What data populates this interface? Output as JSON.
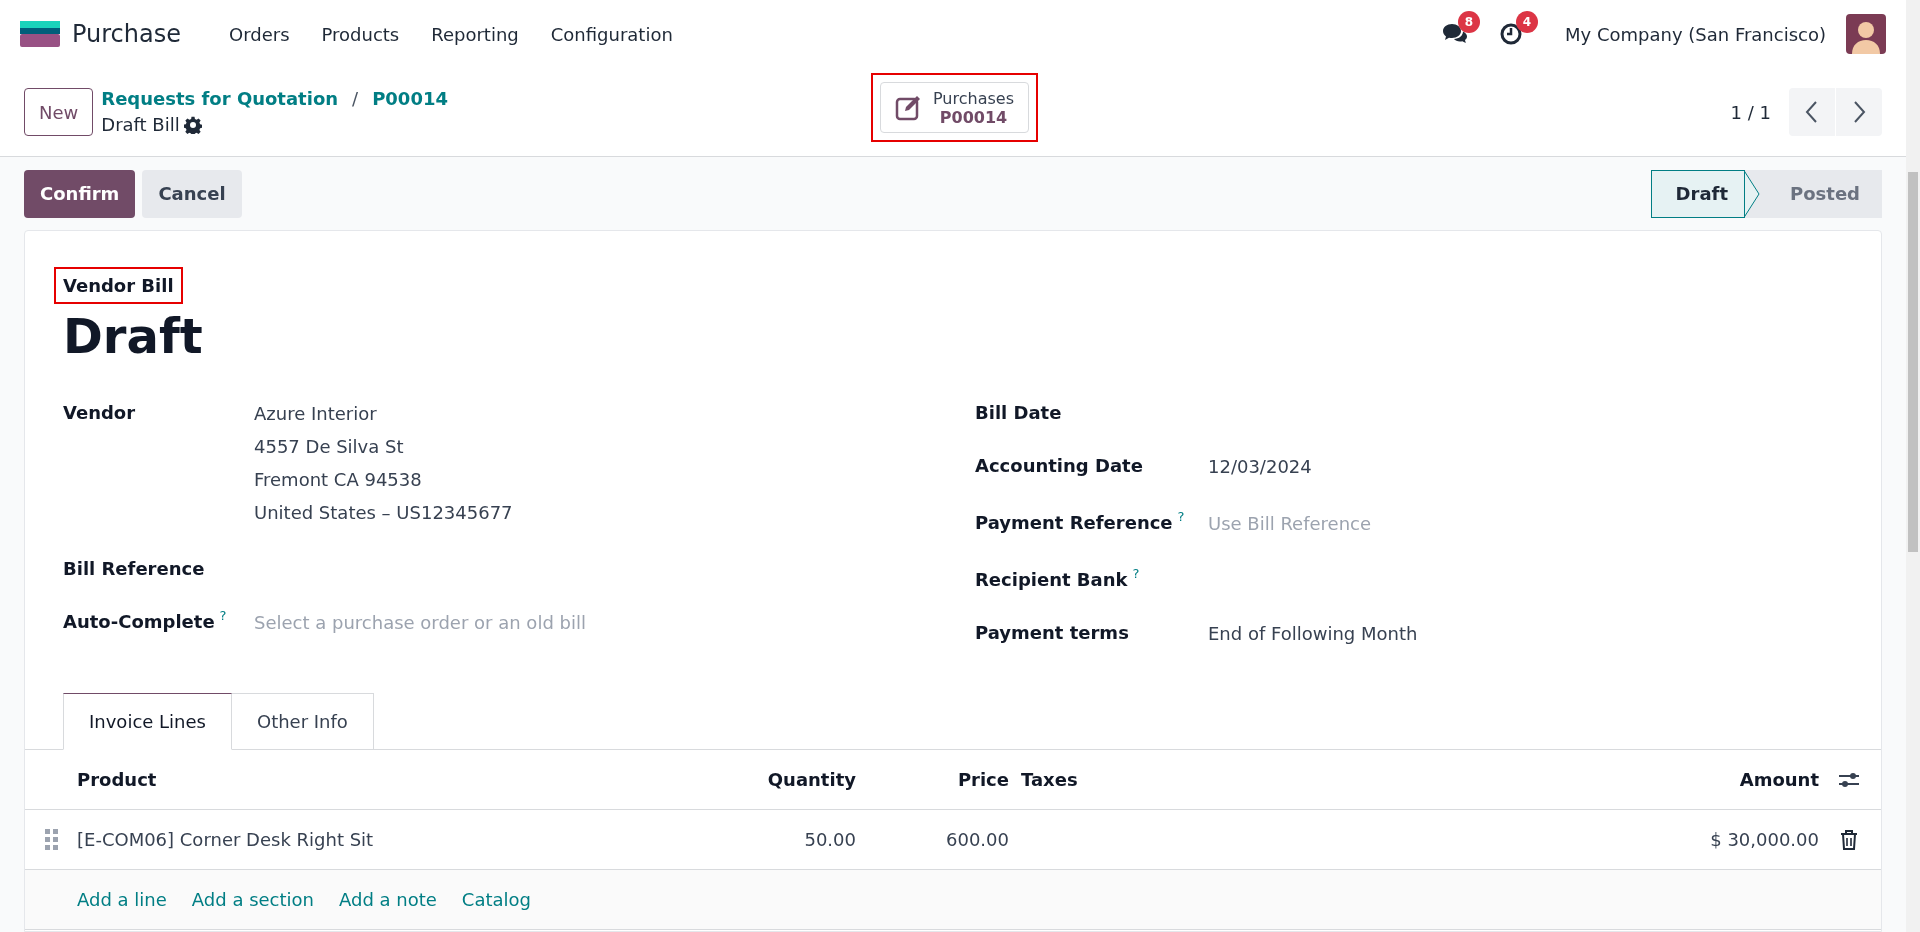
{
  "navbar": {
    "app": "Purchase",
    "menu": [
      "Orders",
      "Products",
      "Reporting",
      "Configuration"
    ],
    "messages_badge": "8",
    "activities_badge": "4",
    "company": "My Company (San Francisco)"
  },
  "control_panel": {
    "new_button": "New",
    "breadcrumb": [
      "Requests for Quotation",
      "P00014"
    ],
    "separator": "/",
    "record": "Draft Bill",
    "smart_button": {
      "label": "Purchases",
      "value": "P00014",
      "highlighted": true
    },
    "pager": "1 / 1"
  },
  "actions": [
    {
      "label": "Confirm",
      "kind": "primary"
    },
    {
      "label": "Cancel",
      "kind": "secondary"
    }
  ],
  "statusbar": [
    {
      "label": "Draft",
      "selected": true
    },
    {
      "label": "Posted",
      "selected": false
    }
  ],
  "form": {
    "type": {
      "label": "Vendor Bill",
      "highlighted": true
    },
    "title": "Draft",
    "left_fields": [
      {
        "label": "Vendor",
        "lines": [
          "Azure Interior",
          "4557 De Silva St",
          "Fremont CA 94538",
          "United States – US12345677"
        ]
      },
      {
        "label": "Bill Reference"
      },
      {
        "label": "Auto-Complete",
        "help": "?",
        "placeholder": "Select a purchase order or an old bill"
      }
    ],
    "right_fields": [
      {
        "label": "Bill Date"
      },
      {
        "label": "Accounting Date",
        "lines": [
          "12/03/2024"
        ]
      },
      {
        "label": "Payment Reference",
        "help": "?",
        "placeholder": "Use Bill Reference"
      },
      {
        "label": "Recipient Bank",
        "help": "?"
      },
      {
        "label": "Payment terms",
        "lines": [
          "End of Following Month"
        ]
      }
    ]
  },
  "tabs": [
    {
      "label": "Invoice Lines",
      "selected": true
    },
    {
      "label": "Other Info",
      "selected": false
    }
  ],
  "table": {
    "columns": [
      "Product",
      "Quantity",
      "Price",
      "Taxes",
      "Amount"
    ],
    "rows": [
      {
        "product": "[E-COM06] Corner Desk Right Sit",
        "quantity": "50.00",
        "price": "600.00",
        "amount": "$ 30,000.00"
      }
    ],
    "add_links": [
      "Add a line",
      "Add a section",
      "Add a note",
      "Catalog"
    ]
  }
}
